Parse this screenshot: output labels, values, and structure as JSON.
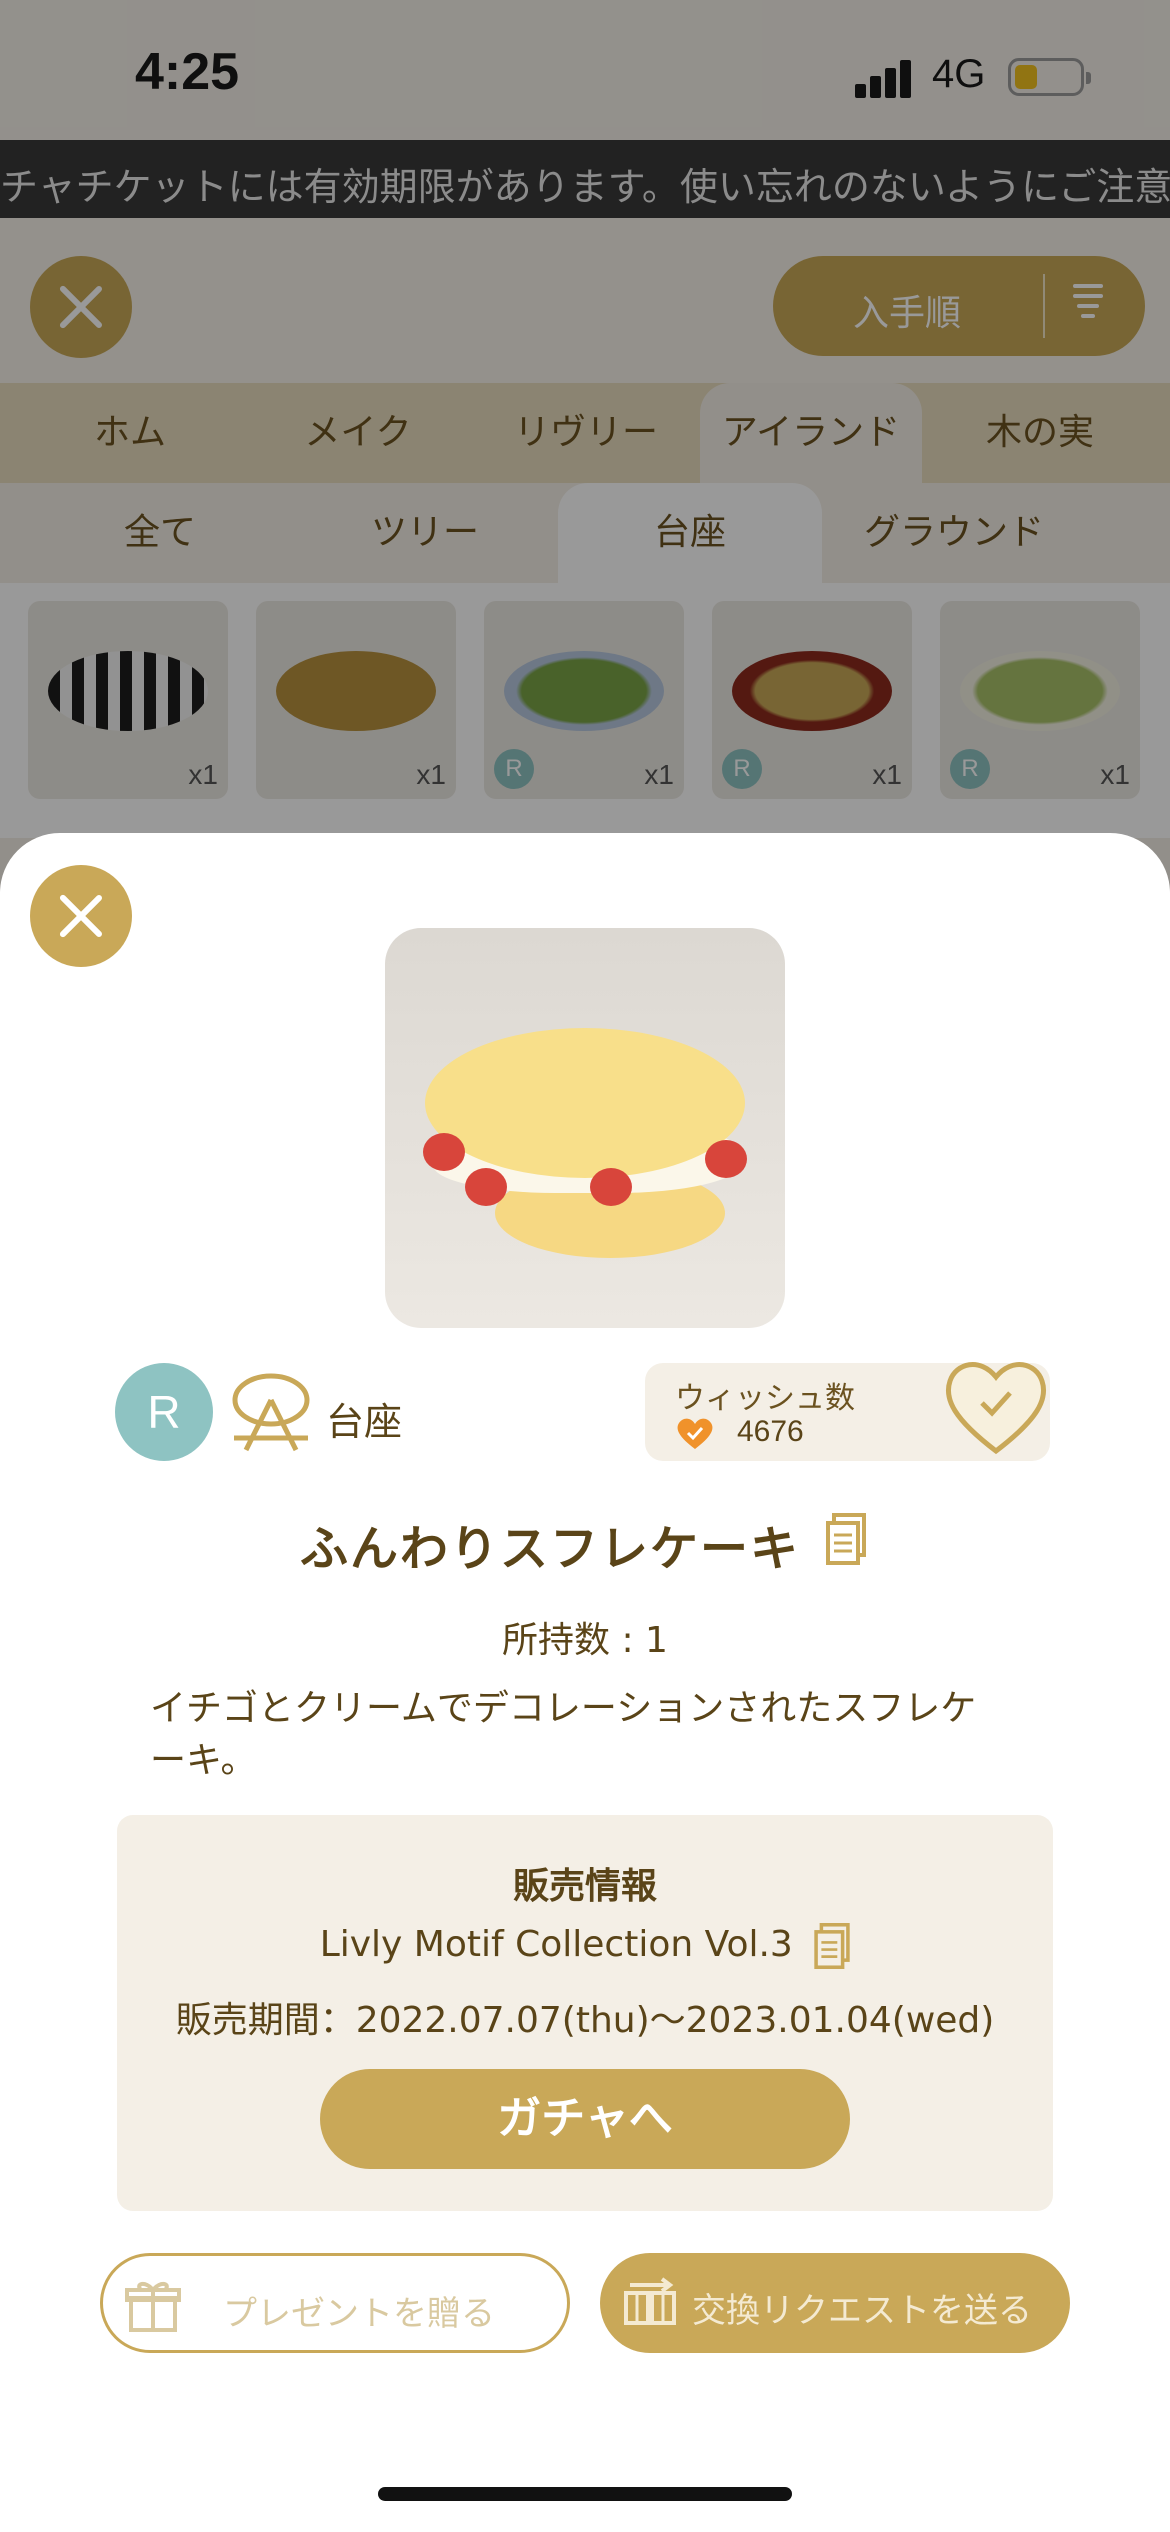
{
  "status_bar": {
    "time": "4:25",
    "network": "4G"
  },
  "ticker": {
    "text": "チャチケットには有効期限があります。使い忘れのないようにご注意く"
  },
  "header": {
    "sort_label": "入手順"
  },
  "category_tabs": [
    "ホム",
    "メイク",
    "リヴリー",
    "アイランド",
    "木の実"
  ],
  "subcategory_tabs": [
    "全て",
    "ツリー",
    "台座",
    "グラウンド"
  ],
  "grid_items": [
    {
      "qty": "x1",
      "rarity": "",
      "color": "#2b2b2b"
    },
    {
      "qty": "x1",
      "rarity": "",
      "color": "#b8913e"
    },
    {
      "qty": "x1",
      "rarity": "R",
      "color": "#7aa447"
    },
    {
      "qty": "x1",
      "rarity": "R",
      "color": "#8c2a1d"
    },
    {
      "qty": "x1",
      "rarity": "R",
      "color": "#a9c26a"
    }
  ],
  "detail": {
    "rarity": "R",
    "category": "台座",
    "wish_label": "ウィッシュ数",
    "wish_count": "4676",
    "name": "ふんわりスフレケーキ",
    "owned": "所持数 : 1",
    "description": "イチゴとクリームでデコレーションされたスフレケーキ。",
    "sale": {
      "title": "販売情報",
      "collection": "Livly Motif Collection Vol.3",
      "period": "販売期間：2022.07.07(thu)〜2023.01.04(wed)",
      "button": "ガチャへ"
    },
    "present_button": "プレゼントを贈る",
    "trade_button": "交換リクエストを送る"
  },
  "colors": {
    "accent": "#c9a858",
    "rarity_r": "#8ec3c2",
    "text": "#5a4418",
    "panel": "#f4efe6"
  }
}
